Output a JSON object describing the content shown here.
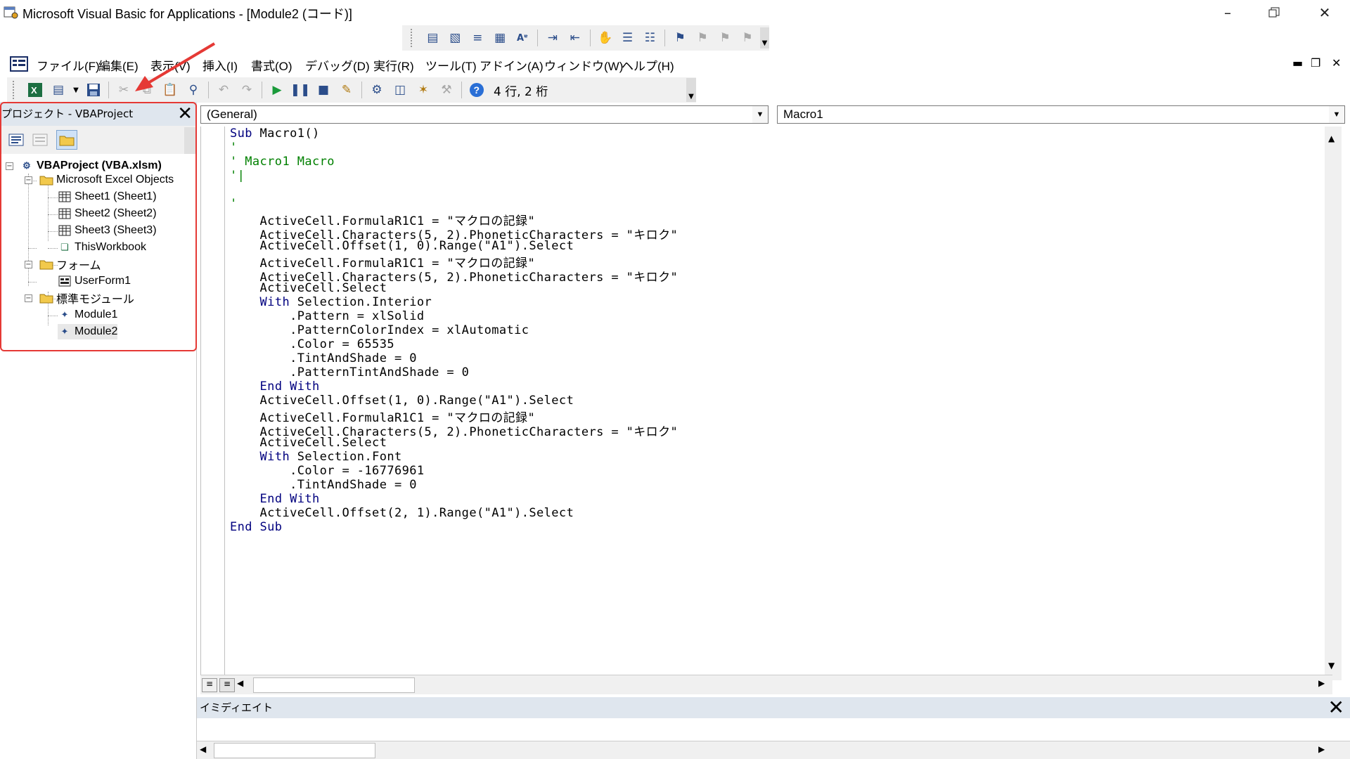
{
  "window": {
    "title": "Microsoft Visual Basic for Applications - [Module2 (コード)]",
    "controls": [
      "minimize",
      "restore",
      "close"
    ]
  },
  "menu": {
    "items": [
      "ファイル(F)",
      "編集(E)",
      "表示(V)",
      "挿入(I)",
      "書式(O)",
      "デバッグ(D)",
      "実行(R)",
      "ツール(T)",
      "アドイン(A)",
      "ウィンドウ(W)",
      "ヘルプ(H)"
    ]
  },
  "toolbar": {
    "cursor_position": "4 行, 2 桁"
  },
  "project": {
    "title": "プロジェクト - VBAProject",
    "tree": {
      "root": "VBAProject (VBA.xlsm)",
      "folders": [
        {
          "label": "Microsoft Excel Objects",
          "children": [
            "Sheet1 (Sheet1)",
            "Sheet2 (Sheet2)",
            "Sheet3 (Sheet3)",
            "ThisWorkbook"
          ]
        },
        {
          "label": "フォーム",
          "children": [
            "UserForm1"
          ]
        },
        {
          "label": "標準モジュール",
          "children": [
            "Module1",
            "Module2"
          ]
        }
      ]
    },
    "selected": "Module2",
    "highlight_color": "#e53935"
  },
  "code": {
    "object_combo": "(General)",
    "procedure_combo": "Macro1",
    "lines": [
      "Sub Macro1()",
      "'",
      "' Macro1 Macro",
      "'|",
      "",
      "'",
      "    ActiveCell.FormulaR1C1 = \"マクロの記録\"",
      "    ActiveCell.Characters(5, 2).PhoneticCharacters = \"キロク\"",
      "    ActiveCell.Offset(1, 0).Range(\"A1\").Select",
      "    ActiveCell.FormulaR1C1 = \"マクロの記録\"",
      "    ActiveCell.Characters(5, 2).PhoneticCharacters = \"キロク\"",
      "    ActiveCell.Select",
      "    With Selection.Interior",
      "        .Pattern = xlSolid",
      "        .PatternColorIndex = xlAutomatic",
      "        .Color = 65535",
      "        .TintAndShade = 0",
      "        .PatternTintAndShade = 0",
      "    End With",
      "    ActiveCell.Offset(1, 0).Range(\"A1\").Select",
      "    ActiveCell.FormulaR1C1 = \"マクロの記録\"",
      "    ActiveCell.Characters(5, 2).PhoneticCharacters = \"キロク\"",
      "    ActiveCell.Select",
      "    With Selection.Font",
      "        .Color = -16776961",
      "        .TintAndShade = 0",
      "    End With",
      "    ActiveCell.Offset(2, 1).Range(\"A1\").Select",
      "End Sub"
    ]
  },
  "immediate": {
    "title": "イミディエイト"
  },
  "colors": {
    "keyword": "#00007f",
    "comment": "#008000",
    "pane_header": "#dfe6ee",
    "annotation_arrow": "#e53935"
  }
}
